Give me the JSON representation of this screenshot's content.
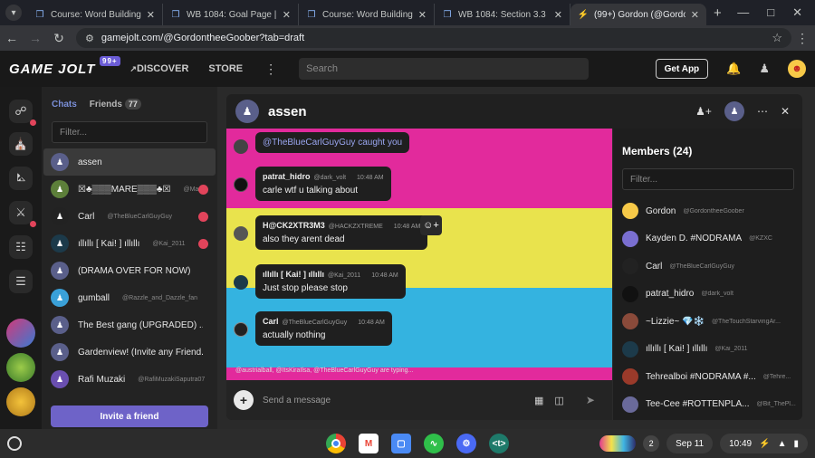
{
  "browser": {
    "tabs": [
      {
        "title": "Course: Word Building 1084",
        "icon": "edu-icon",
        "active": false
      },
      {
        "title": "WB 1084: Goal Page | acec",
        "icon": "edu-icon",
        "active": false
      },
      {
        "title": "Course: Word Building 1084",
        "icon": "edu-icon",
        "active": false
      },
      {
        "title": "WB 1084: Section 3.3 | acec",
        "icon": "edu-icon",
        "active": false
      },
      {
        "title": "(99+) Gordon (@Gordonthee",
        "icon": "gamejolt-icon",
        "active": true
      }
    ],
    "url": "gamejolt.com/@GordontheeGoober?tab=draft"
  },
  "gamejolt": {
    "logo": "GAME JOLT",
    "logo_badge": "99+",
    "nav_discover": "DISCOVER",
    "nav_store": "STORE",
    "search_placeholder": "Search",
    "get_app": "Get App"
  },
  "chat_list": {
    "tab_chats": "Chats",
    "tab_friends": "Friends",
    "friends_count": "77",
    "filter_placeholder": "Filter...",
    "items": [
      {
        "name": "assen",
        "handle": "",
        "color": "#5a5f8a",
        "unread": false,
        "selected": true
      },
      {
        "name": "☒♣▒▒▒MARE▒▒▒♣☒",
        "handle": "@Mare_",
        "color": "#5d7f3a",
        "unread": true,
        "selected": false
      },
      {
        "name": "Carl",
        "handle": "@TheBlueCarlGuyGuy",
        "color": "#222222",
        "unread": true,
        "selected": false
      },
      {
        "name": "ıllıllı [ Kai! ] ıllıllı",
        "handle": "@Kai_2011",
        "color": "#1c3a4a",
        "unread": true,
        "selected": false
      },
      {
        "name": "(DRAMA OVER FOR NOW)",
        "handle": "",
        "color": "#5a5f8a",
        "unread": false,
        "selected": false
      },
      {
        "name": "gumball",
        "handle": "@Razzle_and_Dazzle_fan",
        "color": "#3aa0d8",
        "unread": false,
        "selected": false
      },
      {
        "name": "The Best gang (UPGRADED) ...",
        "handle": "",
        "color": "#5a5f8a",
        "unread": false,
        "selected": false
      },
      {
        "name": "Gardenview! (Invite any Friend...",
        "handle": "",
        "color": "#5a5f8a",
        "unread": false,
        "selected": false
      },
      {
        "name": "Rafi Muzaki",
        "handle": "@RafiMuzakiSaputra07",
        "color": "#6a4fb0",
        "unread": false,
        "selected": false
      }
    ],
    "invite_label": "Invite a friend"
  },
  "chat": {
    "title": "assen",
    "messages": [
      {
        "user": "",
        "handle": "",
        "time": "",
        "text": "@TheBlueCarlGuyGuy  caught you",
        "avatar": "#444444"
      },
      {
        "user": "patrat_hidro",
        "handle": "@dark_volt",
        "time": "10:48 AM",
        "text": "carle wtf u talking about",
        "avatar": "#111111"
      },
      {
        "user": "H@CK2XTR3M3",
        "handle": "@HACKZXTREME",
        "time": "10:48 AM",
        "text": "also they arent dead",
        "avatar": "#555555"
      },
      {
        "user": "ıllıllı [ Kai! ] ıllıllı",
        "handle": "@Kai_2011",
        "time": "10:48 AM",
        "text": "Just stop please stop",
        "avatar": "#1c3a4a"
      },
      {
        "user": "Carl",
        "handle": "@TheBlueCarlGuyGuy",
        "time": "10:48 AM",
        "text": "actually nothing",
        "avatar": "#222222"
      }
    ],
    "typing": "@austrialball, @ItsKiraIlsa, @TheBlueCarlGuyGuy are typing...",
    "composer_placeholder": "Send a message"
  },
  "members": {
    "title": "Members (24)",
    "filter_placeholder": "Filter...",
    "list": [
      {
        "name": "Gordon",
        "handle": "@GordontheeGoober",
        "color": "#f7c948"
      },
      {
        "name": "Kayden D. #NODRAMA",
        "handle": "@KZXC",
        "color": "#7a6fd0"
      },
      {
        "name": "Carl",
        "handle": "@TheBlueCarlGuyGuy",
        "color": "#222222"
      },
      {
        "name": "patrat_hidro",
        "handle": "@dark_volt",
        "color": "#111111"
      },
      {
        "name": "~Lizzie~ 💎❄️",
        "handle": "@TheTouchStarvingAr...",
        "color": "#8a4a3a"
      },
      {
        "name": "ıllıllı [ Kai! ] ıllıllı",
        "handle": "@Kai_2011",
        "color": "#1c3a4a"
      },
      {
        "name": "Tehrealboi #NODRAMA #...",
        "handle": "@Tehre...",
        "color": "#9a3a2a"
      },
      {
        "name": "Tee-Cee #ROTTENPLA...",
        "handle": "@Bit_ThePl...",
        "color": "#6a6a9a"
      }
    ]
  },
  "shelf": {
    "notif_count": "2",
    "date": "Sep 11",
    "time": "10:49"
  }
}
